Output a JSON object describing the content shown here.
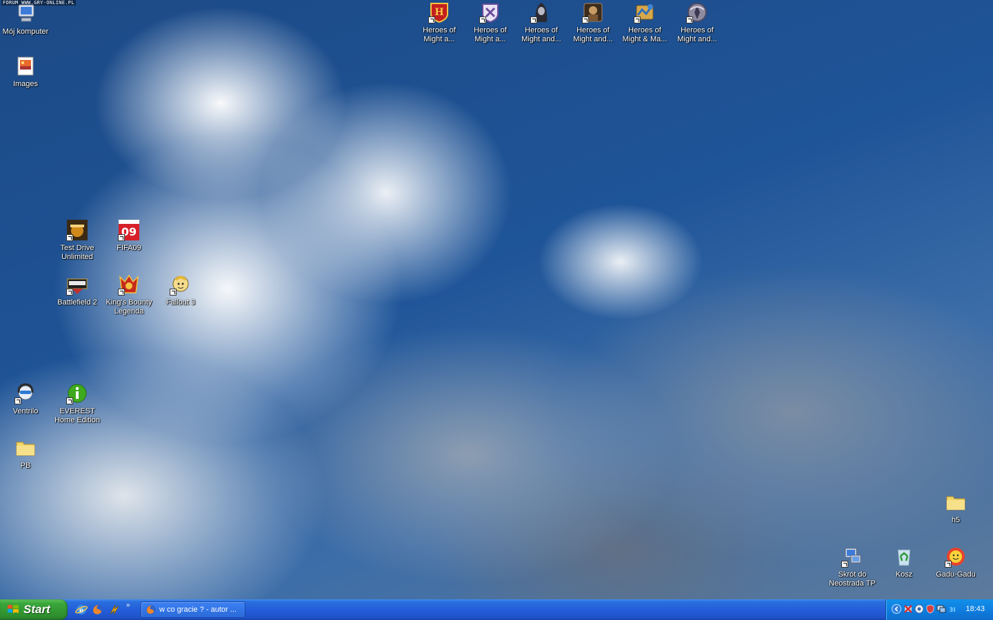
{
  "watermark": "FORUM WWW.GRY-ONLINE.PL",
  "desktop": {
    "icons": [
      {
        "id": "moj-komputer",
        "label": "Mój komputer",
        "icon": "computer-icon"
      },
      {
        "id": "images",
        "label": "Images",
        "icon": "image-folder-icon"
      },
      {
        "id": "homm1",
        "label": "Heroes of Might a...",
        "icon": "heroes-shield-icon"
      },
      {
        "id": "homm2",
        "label": "Heroes of Might a...",
        "icon": "heroes-knight-icon"
      },
      {
        "id": "homm3",
        "label": "Heroes of Might and...",
        "icon": "heroes-dark-icon"
      },
      {
        "id": "homm4",
        "label": "Heroes of Might and...",
        "icon": "heroes-warrior-icon"
      },
      {
        "id": "homm5",
        "label": "Heroes of Might & Ma...",
        "icon": "heroes-map-icon"
      },
      {
        "id": "homm6",
        "label": "Heroes of Might and...",
        "icon": "heroes-crest-icon"
      },
      {
        "id": "tdu",
        "label": "Test Drive Unlimited",
        "icon": "car-game-icon"
      },
      {
        "id": "fifa09",
        "label": "FIFA09",
        "icon": "fifa-icon"
      },
      {
        "id": "bf2",
        "label": "Battlefield 2",
        "icon": "battlefield-icon"
      },
      {
        "id": "kings-bounty",
        "label": "King's Bounty Legenda",
        "icon": "kings-bounty-icon"
      },
      {
        "id": "fallout3",
        "label": "Fallout 3",
        "icon": "vault-boy-icon"
      },
      {
        "id": "ventrilo",
        "label": "Ventrilo",
        "icon": "headset-icon"
      },
      {
        "id": "everest",
        "label": "EVEREST Home Edition",
        "icon": "info-icon"
      },
      {
        "id": "pb",
        "label": "PB",
        "icon": "folder-icon"
      },
      {
        "id": "h5",
        "label": "h5",
        "icon": "folder-icon"
      },
      {
        "id": "neostrada",
        "label": "Skrót do Neostrada TP",
        "icon": "network-icon"
      },
      {
        "id": "kosz",
        "label": "Kosz",
        "icon": "recycle-bin-icon"
      },
      {
        "id": "gadu",
        "label": "Gadu-Gadu",
        "icon": "sun-flower-icon"
      }
    ]
  },
  "taskbar": {
    "start_label": "Start",
    "quick_launch": [
      "internet-explorer-icon",
      "firefox-icon",
      "winamp-icon"
    ],
    "chevron": "»",
    "task_title": "w co gracie ? - autor ...",
    "clock": "18:43"
  },
  "colors": {
    "taskbar_blue": "#245edb",
    "start_green": "#3aa63a",
    "tray_blue": "#0f7fe0"
  }
}
